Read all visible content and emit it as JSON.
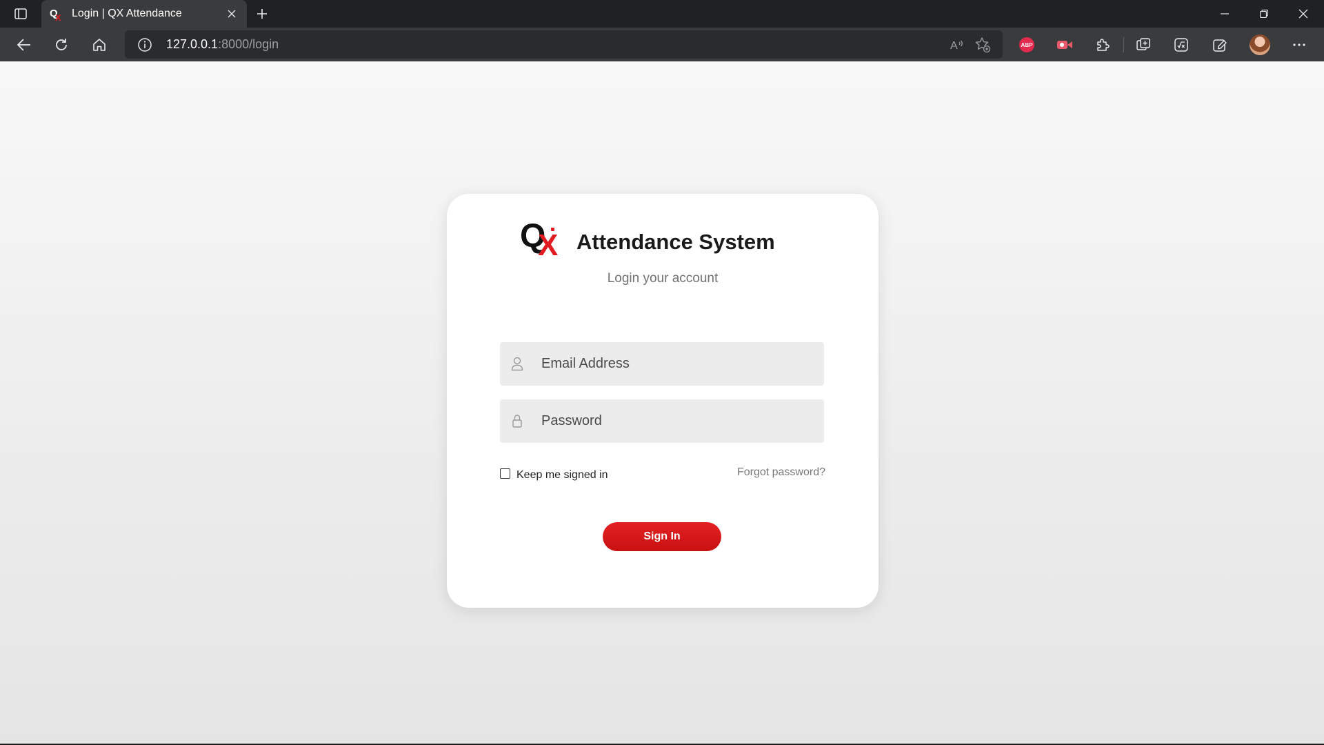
{
  "browser": {
    "tab_title": "Login | QX Attendance",
    "url_host": "127.0.0.1",
    "url_rest": ":8000/login",
    "extensions": {
      "abp_label": "ABP"
    }
  },
  "login": {
    "logo_q": "Q",
    "logo_x": "X",
    "title": "Attendance System",
    "subtitle": "Login your account",
    "email_placeholder": "Email Address",
    "password_placeholder": "Password",
    "remember_label": "Keep me signed in",
    "forgot_label": "Forgot password?",
    "signin_label": "Sign In"
  },
  "colors": {
    "accent": "#e21b23",
    "button": "#d01416",
    "card": "#ffffff",
    "field": "#ececec"
  }
}
